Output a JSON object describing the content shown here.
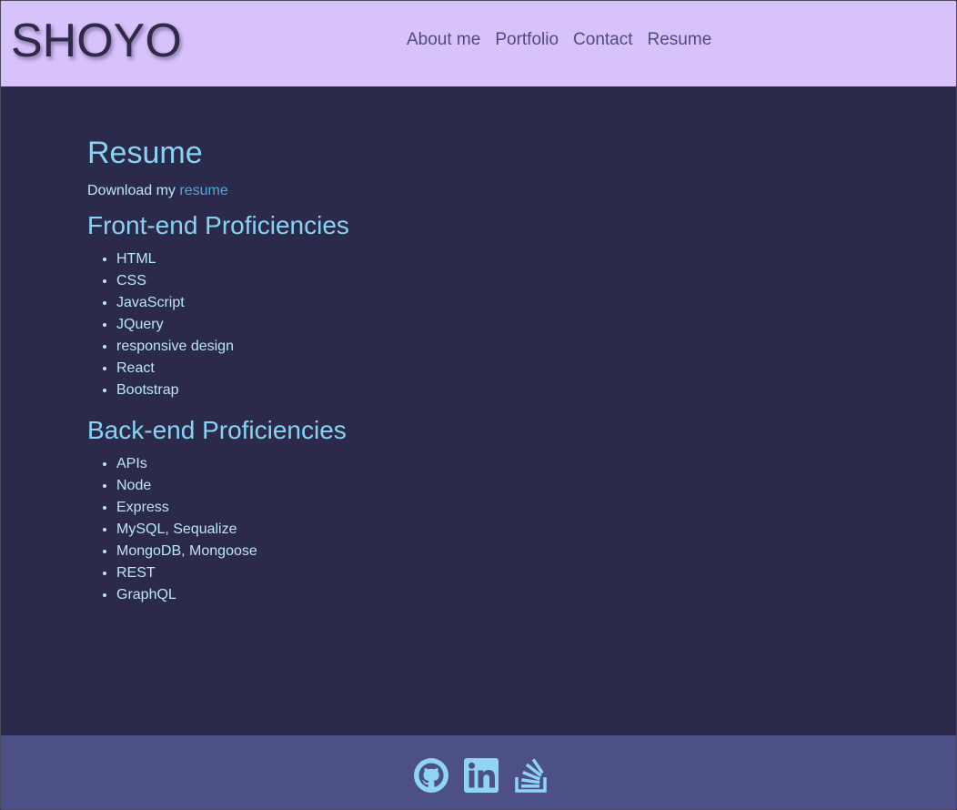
{
  "header": {
    "brand": "SHOYO",
    "nav": [
      {
        "label": "About me"
      },
      {
        "label": "Portfolio"
      },
      {
        "label": "Contact"
      },
      {
        "label": "Resume"
      }
    ]
  },
  "main": {
    "title": "Resume",
    "download_prefix": "Download my ",
    "download_link": "resume",
    "frontend": {
      "heading": "Front-end Proficiencies",
      "items": [
        "HTML",
        "CSS",
        "JavaScript",
        "JQuery",
        "responsive design",
        "React",
        "Bootstrap"
      ]
    },
    "backend": {
      "heading": "Back-end Proficiencies",
      "items": [
        "APIs",
        "Node",
        "Express",
        "MySQL, Sequalize",
        "MongoDB, Mongoose",
        "REST",
        "GraphQL"
      ]
    }
  },
  "footer": {
    "icons": [
      "github-icon",
      "linkedin-icon",
      "stackoverflow-icon"
    ]
  },
  "colors": {
    "header_bg": "#d7c2fb",
    "page_bg": "#2c2a4a",
    "footer_bg": "#4d5087",
    "heading": "#88d2f3",
    "text": "#b9e6f7",
    "link": "#50a6dc",
    "nav": "#4f4c7c",
    "icon": "#8fd3f5"
  }
}
